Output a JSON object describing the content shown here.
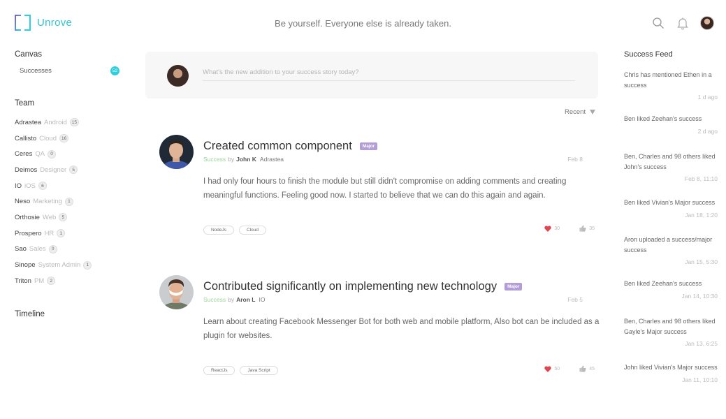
{
  "header": {
    "brand": "Unrove",
    "tagline": "Be yourself. Everyone else is already taken."
  },
  "sidebar": {
    "canvas_title": "Canvas",
    "successes_label": "Successes",
    "successes_count": "52",
    "team_title": "Team",
    "team": [
      {
        "name": "Adrastea",
        "role": "Android",
        "count": "15"
      },
      {
        "name": "Callisto",
        "role": "Cloud",
        "count": "16"
      },
      {
        "name": "Ceres",
        "role": "QA",
        "count": "0"
      },
      {
        "name": "Deimos",
        "role": "Designer",
        "count": "5"
      },
      {
        "name": "IO",
        "role": "iOS",
        "count": "6"
      },
      {
        "name": "Neso",
        "role": "Marketing",
        "count": "1"
      },
      {
        "name": "Orthosie",
        "role": "Web",
        "count": "5"
      },
      {
        "name": "Prospero",
        "role": "HR",
        "count": "1"
      },
      {
        "name": "Sao",
        "role": "Sales",
        "count": "0"
      },
      {
        "name": "Sinope",
        "role": "System Admin",
        "count": "1"
      },
      {
        "name": "Triton",
        "role": "PM",
        "count": "2"
      }
    ],
    "timeline_title": "Timeline"
  },
  "composer": {
    "placeholder": "What's the new addition to your success story today?"
  },
  "sort": {
    "label": "Recent"
  },
  "posts": [
    {
      "title": "Created common component",
      "badge": "Major",
      "status": "Success",
      "by": "by",
      "author": "John K",
      "team": "Adrastea",
      "date": "Feb 8",
      "body": "I had only four hours to finish the module but still didn't compromise on adding comments and creating meaningful functions. Feeling good now. I started to believe that we can do this again and again.",
      "tags": [
        "NodeJs",
        "Cloud"
      ],
      "hearts": "30",
      "likes": "35"
    },
    {
      "title": "Contributed significantly on implementing new technology",
      "badge": "Major",
      "status": "Success",
      "by": "by",
      "author": "Aron L",
      "team": "IO",
      "date": "Feb 5",
      "body": "Learn about creating Facebook Messenger Bot for both web and mobile platform, Also bot can be included as a plugin for websites.",
      "tags": [
        "ReactJs",
        "Java Script"
      ],
      "hearts": "50",
      "likes": "45"
    }
  ],
  "feed": {
    "title": "Success Feed",
    "items": [
      {
        "text": "Chris has mentioned Ethen in a success",
        "time": "1 d ago"
      },
      {
        "text": "Ben liked Zeehan's success",
        "time": "2 d ago"
      },
      {
        "text": "Ben, Charles and 98 others liked John's success",
        "time": "Feb 8,  11:10"
      },
      {
        "text": "Ben liked Vivian's Major success",
        "time": "Jan 18,  1:20"
      },
      {
        "text": "Aron uploaded a success/major success",
        "time": "Jan 15,  5:30"
      },
      {
        "text": "Ben liked Zeehan's success",
        "time": "Jan 14,  10:30"
      },
      {
        "text": "Ben, Charles and 98 others liked Gayle's Major success",
        "time": "Jan 13,  6:25"
      },
      {
        "text": "John liked Vivian's Major success",
        "time": "Jan 11,  10:10"
      }
    ]
  },
  "colors": {
    "accent": "#2ec4d6",
    "major_badge": "#b39dd6",
    "success_text": "#9bd49b",
    "heart": "#e0454f"
  }
}
